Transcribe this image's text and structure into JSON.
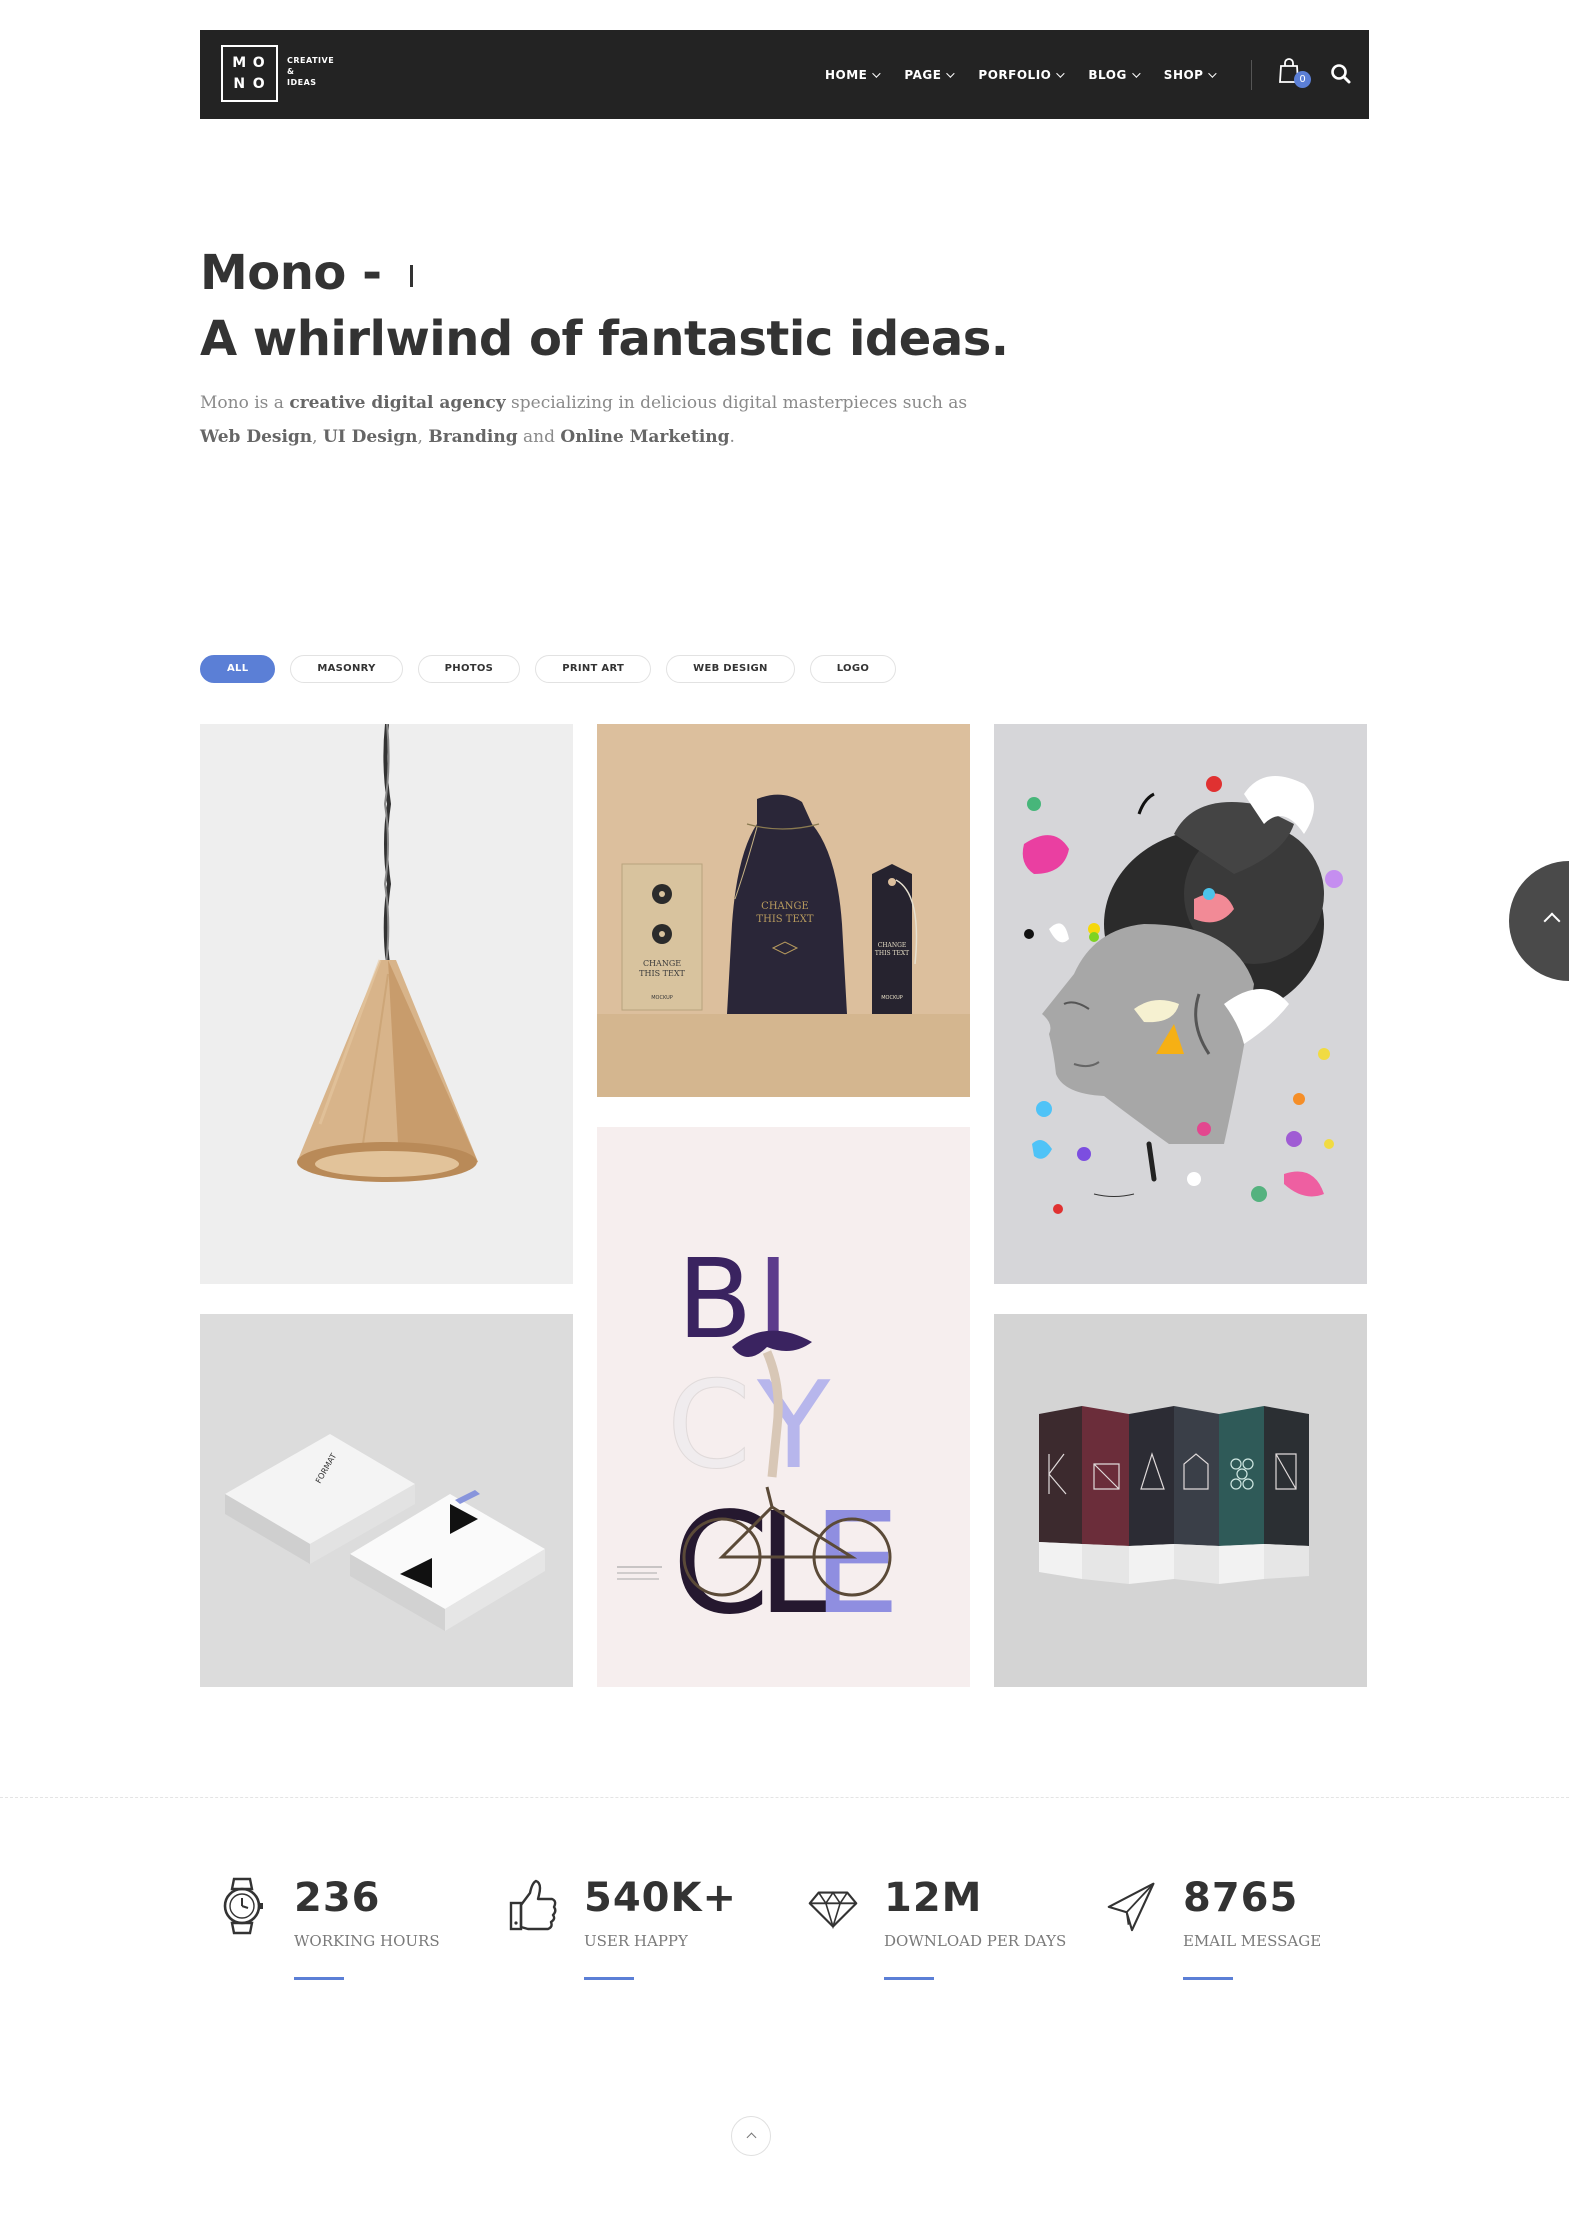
{
  "brand": {
    "logo_letters": [
      "M",
      "O",
      "N",
      "O"
    ],
    "tagline_lines": [
      "CREATIVE",
      "&",
      "IDEAS"
    ]
  },
  "nav": {
    "items": [
      {
        "label": "HOME"
      },
      {
        "label": "PAGE"
      },
      {
        "label": "PORFOLIO"
      },
      {
        "label": "BLOG"
      },
      {
        "label": "SHOP"
      }
    ],
    "cart_count": "0",
    "cart_icon": "shopping-bag-icon",
    "search_icon": "search-icon"
  },
  "hero": {
    "title_prefix": "Mono - ",
    "title_line2": "A whirlwind of fantastic ideas.",
    "desc_parts": {
      "p1": "Mono is a ",
      "b1": "creative digital agency",
      "p2": " specializing in delicious digital masterpieces such as ",
      "b2": "Web Design",
      "p3": ", ",
      "b3": "UI Design",
      "p4": ", ",
      "b4": "Branding",
      "p5": " and ",
      "b5": "Online Marketing",
      "p6": "."
    }
  },
  "filters": [
    {
      "label": "ALL",
      "active": true
    },
    {
      "label": "MASONRY",
      "active": false
    },
    {
      "label": "PHOTOS",
      "active": false
    },
    {
      "label": "PRINT ART",
      "active": false
    },
    {
      "label": "WEB DESIGN",
      "active": false
    },
    {
      "label": "LOGO",
      "active": false
    }
  ],
  "portfolio": {
    "bag_tile": {
      "tag_text_1": "CHANGE",
      "tag_text_2": "THIS TEXT",
      "small_label": "MOCKUP"
    },
    "bike_tile": {
      "letters": [
        "B",
        "I",
        "C",
        "Y",
        "C",
        "L",
        "E"
      ]
    },
    "cards_tile": {
      "card_text": "FORMAT"
    }
  },
  "stats": [
    {
      "icon": "watch-icon",
      "value": "236",
      "label": "WORKING HOURS"
    },
    {
      "icon": "thumbs-up-icon",
      "value": "540K+",
      "label": "USER HAPPY"
    },
    {
      "icon": "diamond-icon",
      "value": "12M",
      "label": "DOWNLOAD PER DAYS"
    },
    {
      "icon": "paper-plane-icon",
      "value": "8765",
      "label": "EMAIL MESSAGE"
    }
  ],
  "colors": {
    "accent": "#5b7fd6",
    "nav_bg": "#232323",
    "text_dark": "#333333",
    "text_muted": "#8a8a8a"
  }
}
